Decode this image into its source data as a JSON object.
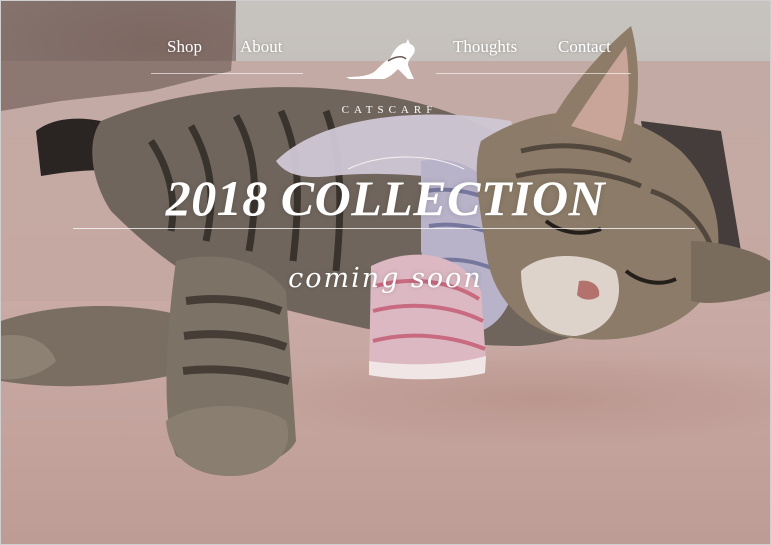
{
  "nav": {
    "items": [
      {
        "label": "Shop"
      },
      {
        "label": "About"
      },
      {
        "label": "Thoughts"
      },
      {
        "label": "Contact"
      }
    ]
  },
  "brand": {
    "name": "CATSCARF",
    "logo_icon": "cat-silhouette-icon"
  },
  "hero": {
    "title": "2018 COLLECTION",
    "subtitle": "coming soon"
  },
  "colors": {
    "text": "#ffffff",
    "bed": "#c6a8a2",
    "wall": "#c4c0bc"
  }
}
